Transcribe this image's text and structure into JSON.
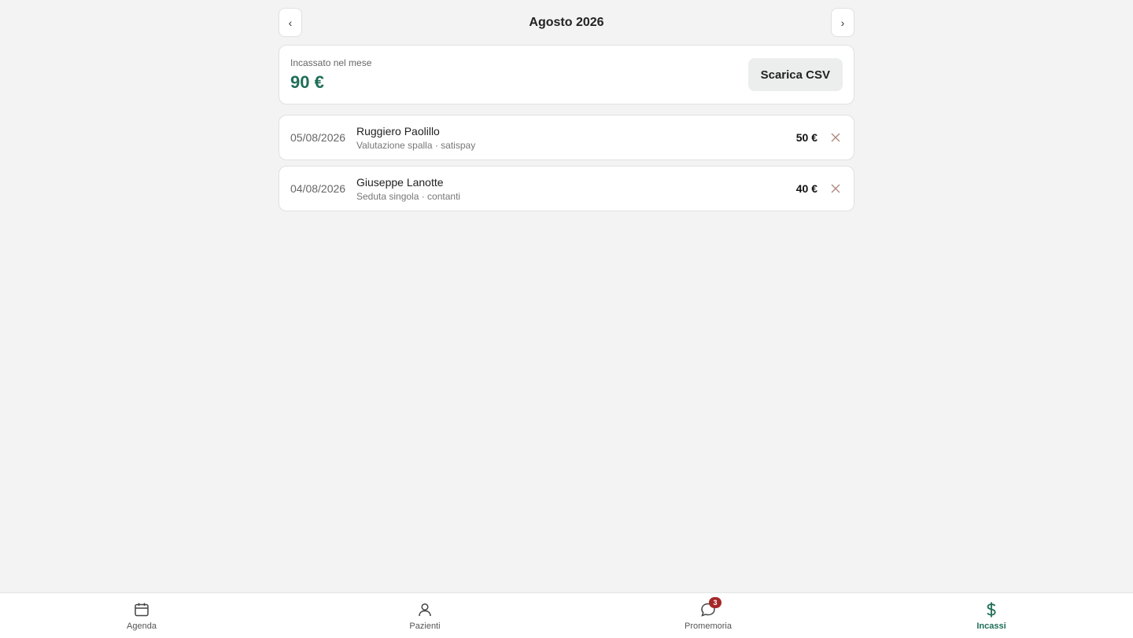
{
  "month_nav": {
    "prev_label": "‹",
    "next_label": "›",
    "title": "Agosto 2026"
  },
  "summary": {
    "label": "Incassato nel mese",
    "amount": "90 €",
    "csv_button": "Scarica CSV"
  },
  "payments": [
    {
      "date": "05/08/2026",
      "name": "Ruggiero Paolillo",
      "detail": "Valutazione spalla · satispay",
      "amount": "50 €",
      "delete_icon": "close-icon"
    },
    {
      "date": "04/08/2026",
      "name": "Giuseppe Lanotte",
      "detail": "Seduta singola · contanti",
      "amount": "40 €",
      "delete_icon": "close-icon"
    }
  ],
  "bottom_nav": {
    "tabs": [
      {
        "label": "Agenda",
        "icon": "calendar-icon",
        "active": false
      },
      {
        "label": "Pazienti",
        "icon": "user-icon",
        "active": false
      },
      {
        "label": "Promemoria",
        "icon": "chat-bubble-icon",
        "active": false,
        "badge": "3"
      },
      {
        "label": "Incassi",
        "icon": "dollar-icon",
        "active": true
      }
    ]
  },
  "colors": {
    "accent": "#1f6e57",
    "background": "#f2f3f2",
    "badge": "#a42828"
  }
}
